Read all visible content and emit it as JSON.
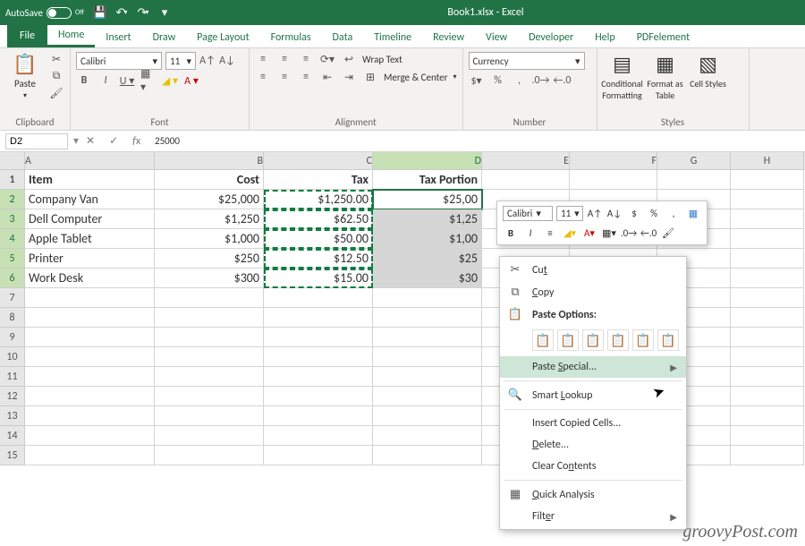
{
  "titlebar": {
    "autosave_label": "AutoSave",
    "autosave_state": "Off",
    "title": "Book1.xlsx - Excel"
  },
  "tabs": [
    "File",
    "Home",
    "Insert",
    "Draw",
    "Page Layout",
    "Formulas",
    "Data",
    "Timeline",
    "Review",
    "View",
    "Developer",
    "Help",
    "PDFelement"
  ],
  "active_tab": "Home",
  "ribbon": {
    "clipboard": {
      "paste": "Paste",
      "label": "Clipboard"
    },
    "font": {
      "name": "Calibri",
      "size": "11",
      "label": "Font"
    },
    "alignment": {
      "wrap": "Wrap Text",
      "merge": "Merge & Center",
      "label": "Alignment"
    },
    "number": {
      "format": "Currency",
      "label": "Number"
    },
    "styles": {
      "cond": "Conditional Formatting",
      "fat": "Format as Table",
      "cell": "Cell Styles",
      "label": "Styles"
    }
  },
  "formula_bar": {
    "name_box": "D2",
    "value": "25000"
  },
  "columns": [
    "A",
    "B",
    "C",
    "D",
    "E",
    "F",
    "G",
    "H"
  ],
  "headers": {
    "A": "Item",
    "B": "Cost",
    "C": "Tax",
    "D": "Tax Portion"
  },
  "rows": [
    {
      "A": "Company Van",
      "B": "$25,000",
      "C": "$1,250.00",
      "D": "$25,00"
    },
    {
      "A": "Dell Computer",
      "B": "$1,250",
      "C": "$62.50",
      "D": "$1,25"
    },
    {
      "A": "Apple Tablet",
      "B": "$1,000",
      "C": "$50.00",
      "D": "$1,00"
    },
    {
      "A": "Printer",
      "B": "$250",
      "C": "$12.50",
      "D": "$25"
    },
    {
      "A": "Work Desk",
      "B": "$300",
      "C": "$15.00",
      "D": "$30"
    }
  ],
  "mini": {
    "font": "Calibri",
    "size": "11"
  },
  "context_menu": {
    "cut": "Cut",
    "copy": "Copy",
    "paste_options": "Paste Options:",
    "paste_special": "Paste Special...",
    "smart_lookup": "Smart Lookup",
    "insert_copied": "Insert Copied Cells...",
    "delete": "Delete...",
    "clear": "Clear Contents",
    "quick_analysis": "Quick Analysis",
    "filter": "Filter"
  },
  "watermark": "groovyPost.com"
}
